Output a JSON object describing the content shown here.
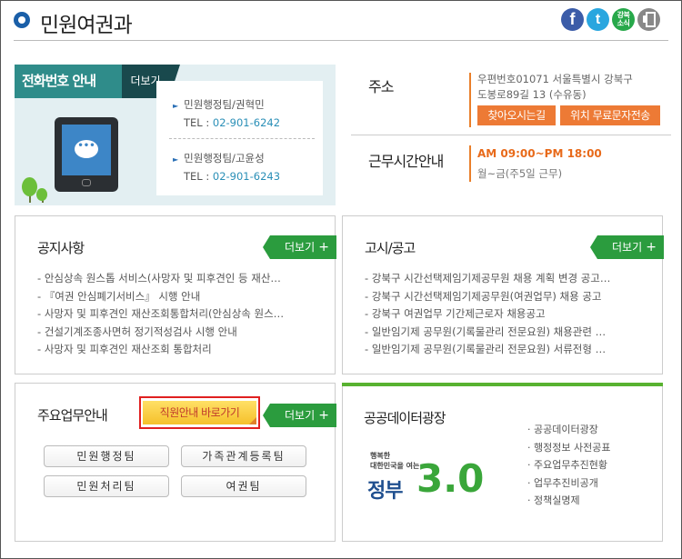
{
  "header": {
    "title": "민원여권과",
    "social": {
      "facebook": "f",
      "twitter": "t",
      "share": "강북\n소식",
      "print": "print-icon"
    }
  },
  "phone": {
    "title": "전화번호 안내",
    "more": "더보기",
    "entries": [
      {
        "name": "민원행정팀/권혁민",
        "tel_label": "TEL :",
        "tel": "02-901-6242"
      },
      {
        "name": "민원행정팀/고윤성",
        "tel_label": "TEL :",
        "tel": "02-901-6243"
      }
    ]
  },
  "address": {
    "label": "주소",
    "line1": "우편번호01071 서울특별시 강북구",
    "line2": "도봉로89길 13 (수유동)",
    "directions": "찾아오시는길",
    "sms": "위치 무료문자전송"
  },
  "hours": {
    "label": "근무시간안내",
    "time": "AM 09:00~PM 18:00",
    "days": "월~금(주5일 근무)"
  },
  "notice": {
    "title": "공지사항",
    "more": "더보기",
    "items": [
      "안심상속 원스톱 서비스(사망자 및 피후견인 등 재산…",
      "『여권 안심폐기서비스』 시행 안내",
      "사망자 및 피후견인 재산조회통합처리(안심상속 원스…",
      "건설기계조종사면허 정기적성검사 시행 안내",
      "사망자 및 피후견인 재산조회 통합처리"
    ]
  },
  "announce": {
    "title": "고시/공고",
    "more": "더보기",
    "items": [
      "강북구 시간선택제임기제공무원 채용 계획 변경 공고…",
      "강북구 시간선택제임기제공무원(여권업무) 채용 공고",
      "강북구 여권업무 기간제근로자 채용공고",
      "일반임기제 공무원(기록물관리 전문요원) 채용관련 …",
      "일반임기제 공무원(기록물관리 전문요원) 서류전형 …"
    ]
  },
  "tasks": {
    "title": "주요업무안내",
    "shortcut": "직원안내 바로가기",
    "more": "더보기",
    "teams": [
      "민원행정팀",
      "가족관계등록팀",
      "민원처리팀",
      "여권팀"
    ]
  },
  "open_data": {
    "title": "공공데이터광장",
    "logo_small": "행복한\n대한민국을 여는",
    "logo_word": "정부",
    "logo_num": "3.0",
    "items": [
      "공공데이터광장",
      "행정정보 사전공표",
      "주요업무추진현황",
      "업무추진비공개",
      "정책실명제"
    ]
  },
  "colors": {
    "accent_blue": "#1a5fa8",
    "teal": "#2f8c8a",
    "green": "#2b9c3e",
    "orange": "#ed7a35",
    "highlight_red": "#e02020"
  }
}
